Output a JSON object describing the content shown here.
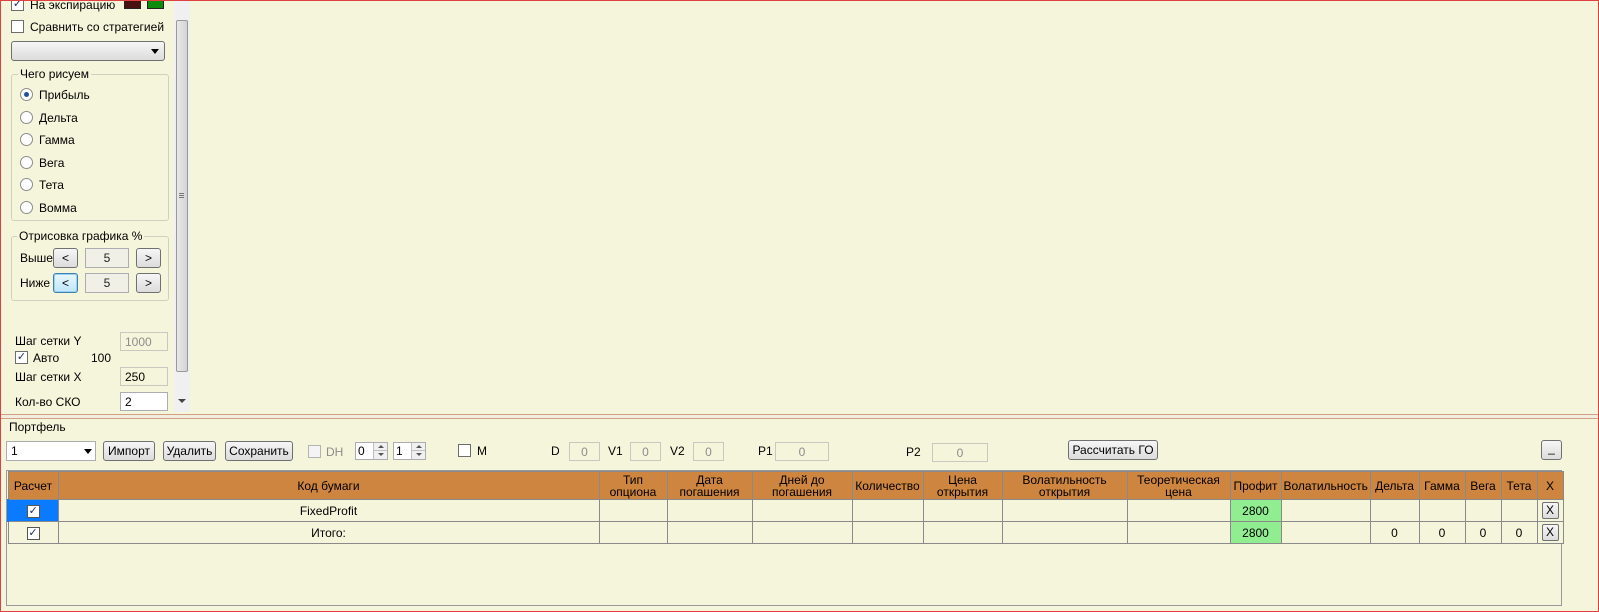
{
  "left_panel": {
    "expiry_checkbox": {
      "label": "На экспирацию",
      "checked": true
    },
    "compare_checkbox": {
      "label": "Сравнить со стратегией",
      "checked": false
    },
    "strategy_select": {
      "value": ""
    },
    "what_to_draw": {
      "title": "Чего рисуем",
      "options": [
        {
          "label": "Прибыль",
          "selected": true
        },
        {
          "label": "Дельта",
          "selected": false
        },
        {
          "label": "Гамма",
          "selected": false
        },
        {
          "label": "Вега",
          "selected": false
        },
        {
          "label": "Тета",
          "selected": false
        },
        {
          "label": "Вомма",
          "selected": false
        }
      ]
    },
    "chart_drawing": {
      "title": "Отрисовка графика %",
      "above_label": "Выше",
      "above_value": "5",
      "below_label": "Ниже",
      "below_value": "5",
      "dec_label": "<",
      "inc_label": ">"
    },
    "grid_step_y_label": "Шаг сетки Y",
    "grid_step_y_value": "1000",
    "auto_label": "Авто",
    "auto_value": "100",
    "grid_step_x_label": "Шаг сетки X",
    "grid_step_x_value": "250",
    "sko_label": "Кол-во СКО",
    "sko_value": "2"
  },
  "colors": {
    "swatch1": "#4a1010",
    "swatch2": "#0c8a0c",
    "header_bg": "#cd853f",
    "profit_bg": "#90ee90",
    "panel_bg": "#f5f5dc"
  },
  "portfolio": {
    "title": "Портфель",
    "select_value": "1",
    "import_label": "Импорт",
    "delete_label": "Удалить",
    "save_label": "Сохранить",
    "dh_label": "DH",
    "spin1_value": "0",
    "spin2_value": "1",
    "m_label": "M",
    "d_label": "D",
    "d_value": "0",
    "v1_label": "V1",
    "v1_value": "0",
    "v2_label": "V2",
    "v2_value": "0",
    "p1_label": "P1",
    "p1_value": "0",
    "p2_label": "P2",
    "p2_value": "0",
    "calc_go_label": "Рассчитать ГО",
    "minimize_label": "_"
  },
  "table": {
    "headers": {
      "calc": "Расчет",
      "code": "Код бумаги",
      "option_type": "Тип\nопциона",
      "exp_date": "Дата\nпогашения",
      "days_to_exp": "Дней до\nпогашения",
      "quantity": "Количество",
      "open_price": "Цена\nоткрытия",
      "open_vol": "Волатильность\nоткрытия",
      "theo_price": "Теоретическая\nцена",
      "profit": "Профит",
      "volatility": "Волатильность",
      "delta": "Дельта",
      "gamma": "Гамма",
      "vega": "Вега",
      "theta": "Тета",
      "x": "X"
    },
    "rows": [
      {
        "checked": true,
        "code": "FixedProfit",
        "option_type": "",
        "exp_date": "",
        "days_to_exp": "",
        "quantity": "",
        "open_price": "",
        "open_vol": "",
        "theo_price": "",
        "profit": "2800",
        "volatility": "",
        "delta": "",
        "gamma": "",
        "vega": "",
        "theta": "",
        "x": "X"
      },
      {
        "checked": true,
        "code": "Итого:",
        "option_type": "",
        "exp_date": "",
        "days_to_exp": "",
        "quantity": "",
        "open_price": "",
        "open_vol": "",
        "theo_price": "",
        "profit": "2800",
        "volatility": "",
        "delta": "0",
        "gamma": "0",
        "vega": "0",
        "theta": "0",
        "x": "X"
      }
    ]
  }
}
